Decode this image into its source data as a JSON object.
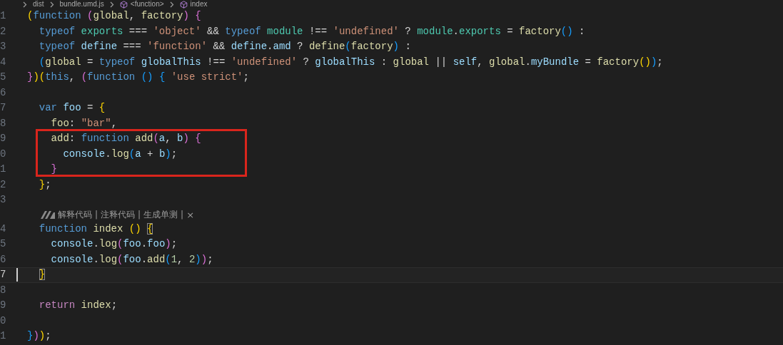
{
  "breadcrumb": [
    "dist",
    "bundle.umd.js",
    "<function>",
    "index"
  ],
  "lines": [
    {
      "kind": "code",
      "number": "1",
      "active": false,
      "bracket_matched": false,
      "tokens": [
        {
          "t": "("
        },
        {
          "t": "function",
          "color": "#569cd6"
        },
        {
          "t": " ("
        },
        {
          "t": "global",
          "color": "#dcdcaa"
        },
        {
          "t": ", "
        },
        {
          "t": "factory",
          "color": "#dcdcaa"
        },
        {
          "t": ") {"
        }
      ]
    },
    {
      "kind": "code",
      "number": "2",
      "active": false,
      "bracket_matched": false,
      "tokens": [
        {
          "t": "  typeof",
          "color": "#569cd6"
        },
        {
          "t": " exports",
          "color": "#4ec9b0"
        },
        {
          "t": " === "
        },
        {
          "t": "'object'",
          "color": "#ce9178"
        },
        {
          "t": " && "
        },
        {
          "t": "typeof",
          "color": "#569cd6"
        },
        {
          "t": " module",
          "color": "#4ec9b0"
        },
        {
          "t": " !== "
        },
        {
          "t": "'undefined'",
          "color": "#ce9178"
        },
        {
          "t": " ? "
        },
        {
          "t": "module",
          "color": "#4ec9b0"
        },
        {
          "t": "."
        },
        {
          "t": "exports",
          "color": "#4ec9b0"
        },
        {
          "t": " = "
        },
        {
          "t": "factory",
          "color": "#dcdcaa"
        },
        {
          "t": "() :"
        }
      ]
    },
    {
      "kind": "code",
      "number": "3",
      "active": false,
      "bracket_matched": false,
      "tokens": [
        {
          "t": "  typeof",
          "color": "#569cd6"
        },
        {
          "t": " define",
          "color": "#9cdcfe"
        },
        {
          "t": " === "
        },
        {
          "t": "'function'",
          "color": "#ce9178"
        },
        {
          "t": " && "
        },
        {
          "t": "define",
          "color": "#9cdcfe"
        },
        {
          "t": "."
        },
        {
          "t": "amd",
          "color": "#9cdcfe"
        },
        {
          "t": " ? "
        },
        {
          "t": "define",
          "color": "#dcdcaa"
        },
        {
          "t": "("
        },
        {
          "t": "factory",
          "color": "#dcdcaa"
        },
        {
          "t": ") :"
        }
      ]
    },
    {
      "kind": "code",
      "number": "4",
      "active": false,
      "bracket_matched": false,
      "tokens": [
        {
          "t": "  ("
        },
        {
          "t": "global",
          "color": "#dcdcaa"
        },
        {
          "t": " = "
        },
        {
          "t": "typeof",
          "color": "#569cd6"
        },
        {
          "t": " globalThis",
          "color": "#9cdcfe"
        },
        {
          "t": " !== "
        },
        {
          "t": "'undefined'",
          "color": "#ce9178"
        },
        {
          "t": " ? "
        },
        {
          "t": "globalThis",
          "color": "#9cdcfe"
        },
        {
          "t": " : "
        },
        {
          "t": "global",
          "color": "#dcdcaa"
        },
        {
          "t": " || "
        },
        {
          "t": "self",
          "color": "#9cdcfe"
        },
        {
          "t": ", "
        },
        {
          "t": "global",
          "color": "#dcdcaa"
        },
        {
          "t": "."
        },
        {
          "t": "myBundle",
          "color": "#9cdcfe"
        },
        {
          "t": " = "
        },
        {
          "t": "factory",
          "color": "#dcdcaa"
        },
        {
          "t": "());"
        }
      ]
    },
    {
      "kind": "code",
      "number": "5",
      "active": false,
      "bracket_matched": false,
      "tokens": [
        {
          "t": "})("
        },
        {
          "t": "this",
          "color": "#569cd6"
        },
        {
          "t": ", ("
        },
        {
          "t": "function",
          "color": "#569cd6"
        },
        {
          "t": " () { "
        },
        {
          "t": "'use strict'",
          "color": "#ce9178"
        },
        {
          "t": ";"
        }
      ]
    },
    {
      "kind": "code",
      "number": "6",
      "active": false
    },
    {
      "kind": "code",
      "number": "7",
      "active": false,
      "bracket_matched": false,
      "tokens": [
        {
          "t": "  var",
          "color": "#569cd6"
        },
        {
          "t": " foo",
          "color": "#9cdcfe"
        },
        {
          "t": " = {"
        }
      ]
    },
    {
      "kind": "code",
      "number": "8",
      "active": false,
      "bracket_matched": false,
      "tokens": [
        {
          "t": "    foo",
          "color": "#dcdcaa"
        },
        {
          "t": ": "
        },
        {
          "t": "\"bar\"",
          "color": "#ce9178"
        },
        {
          "t": ","
        }
      ]
    },
    {
      "kind": "code",
      "number": "9",
      "active": false,
      "bracket_matched": false,
      "tokens": [
        {
          "t": "    add",
          "color": "#dcdcaa"
        },
        {
          "t": ": "
        },
        {
          "t": "function",
          "color": "#569cd6"
        },
        {
          "t": " add",
          "color": "#dcdcaa"
        },
        {
          "t": "("
        },
        {
          "t": "a",
          "color": "#9cdcfe"
        },
        {
          "t": ", "
        },
        {
          "t": "b",
          "color": "#9cdcfe"
        },
        {
          "t": ") {"
        }
      ]
    },
    {
      "kind": "code",
      "number": "0",
      "active": false,
      "bracket_matched": false,
      "tokens": [
        {
          "t": "      console",
          "color": "#9cdcfe"
        },
        {
          "t": "."
        },
        {
          "t": "log",
          "color": "#dcdcaa"
        },
        {
          "t": "("
        },
        {
          "t": "a",
          "color": "#9cdcfe"
        },
        {
          "t": " + "
        },
        {
          "t": "b",
          "color": "#9cdcfe"
        },
        {
          "t": ");"
        }
      ]
    },
    {
      "kind": "code",
      "number": "1",
      "active": false,
      "bracket_matched": false,
      "tokens": [
        {
          "t": "    }"
        }
      ]
    },
    {
      "kind": "code",
      "number": "2",
      "active": false,
      "bracket_matched": false,
      "tokens": [
        {
          "t": "  };"
        }
      ]
    },
    {
      "kind": "code",
      "number": "3",
      "active": false
    },
    {
      "kind": "codelens",
      "items": [
        "解释代码",
        "注释代码",
        "生成单测"
      ],
      "separator": "|",
      "close": "×"
    },
    {
      "kind": "code",
      "number": "4",
      "active": false,
      "bracket_matched": true,
      "tokens": [
        {
          "t": "  function",
          "color": "#569cd6"
        },
        {
          "t": " index",
          "color": "#dcdcaa"
        },
        {
          "t": " () {"
        }
      ]
    },
    {
      "kind": "code",
      "number": "5",
      "active": false,
      "bracket_matched": false,
      "tokens": [
        {
          "t": "    console",
          "color": "#9cdcfe"
        },
        {
          "t": "."
        },
        {
          "t": "log",
          "color": "#dcdcaa"
        },
        {
          "t": "("
        },
        {
          "t": "foo",
          "color": "#9cdcfe"
        },
        {
          "t": "."
        },
        {
          "t": "foo",
          "color": "#9cdcfe"
        },
        {
          "t": ");"
        }
      ]
    },
    {
      "kind": "code",
      "number": "6",
      "active": false,
      "bracket_matched": false,
      "tokens": [
        {
          "t": "    console",
          "color": "#9cdcfe"
        },
        {
          "t": "."
        },
        {
          "t": "log",
          "color": "#dcdcaa"
        },
        {
          "t": "("
        },
        {
          "t": "foo",
          "color": "#9cdcfe"
        },
        {
          "t": "."
        },
        {
          "t": "add",
          "color": "#dcdcaa"
        },
        {
          "t": "("
        },
        {
          "t": "1",
          "color": "#b5cea8"
        },
        {
          "t": ", "
        },
        {
          "t": "2",
          "color": "#b5cea8"
        },
        {
          "t": "));"
        }
      ]
    },
    {
      "kind": "code",
      "number": "7",
      "active": true,
      "bracket_matched": true,
      "tokens": [
        {
          "t": "  }"
        }
      ]
    },
    {
      "kind": "code",
      "number": "8",
      "active": false
    },
    {
      "kind": "code",
      "number": "9",
      "active": false,
      "bracket_matched": false,
      "tokens": [
        {
          "t": "  return",
          "color": "#c586c0"
        },
        {
          "t": " index",
          "color": "#dcdcaa"
        },
        {
          "t": ";"
        }
      ]
    },
    {
      "kind": "code",
      "number": "0",
      "active": false
    },
    {
      "kind": "code",
      "number": "1",
      "active": false,
      "bracket_matched": false,
      "tokens": [
        {
          "t": "}));"
        }
      ]
    }
  ]
}
